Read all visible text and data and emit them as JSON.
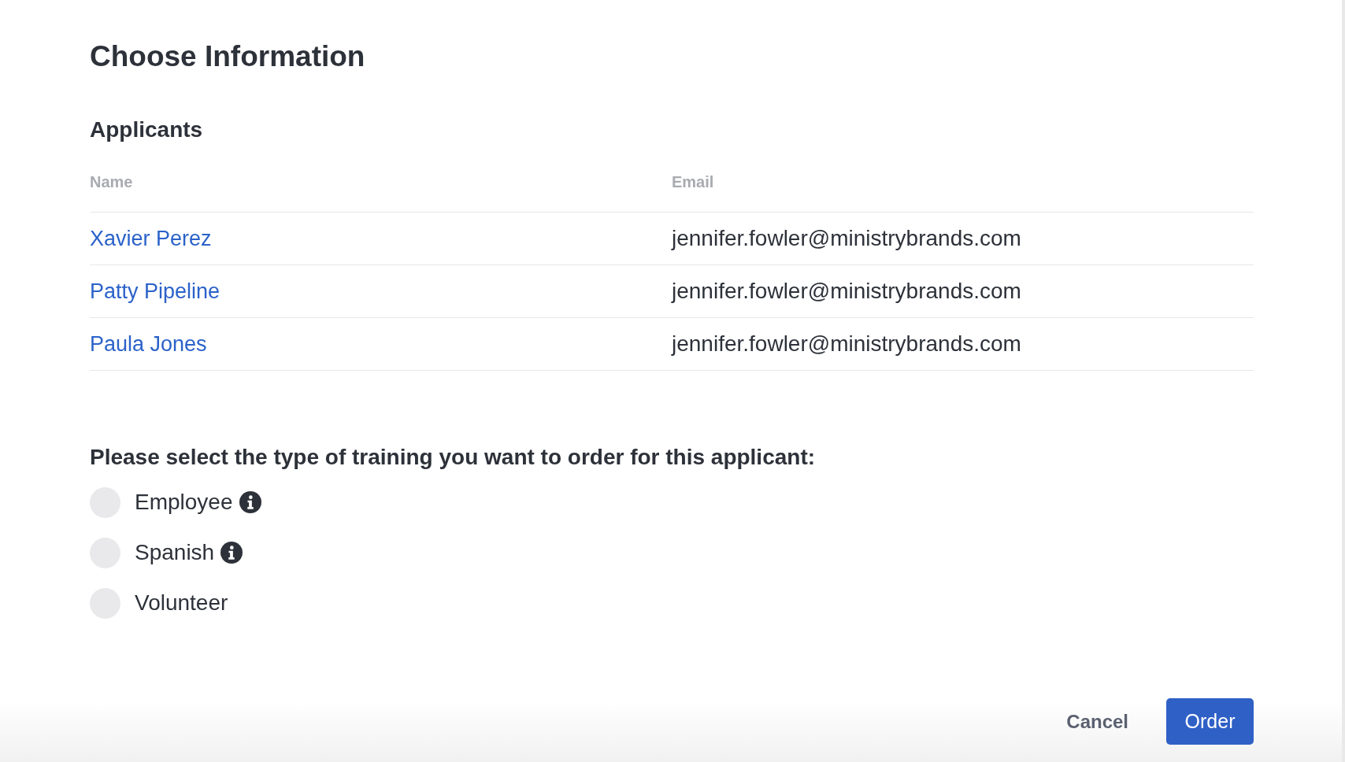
{
  "dialog": {
    "title": "Choose Information"
  },
  "applicants": {
    "heading": "Applicants",
    "columns": [
      "Name",
      "Email"
    ],
    "rows": [
      {
        "name": "Xavier Perez",
        "email": "jennifer.fowler@ministrybrands.com"
      },
      {
        "name": "Patty Pipeline",
        "email": "jennifer.fowler@ministrybrands.com"
      },
      {
        "name": "Paula Jones",
        "email": "jennifer.fowler@ministrybrands.com"
      }
    ]
  },
  "training": {
    "question": "Please select the type of training you want to order for this applicant:",
    "options": [
      {
        "label": "Employee",
        "info": true,
        "selected": false
      },
      {
        "label": "Spanish",
        "info": true,
        "selected": false
      },
      {
        "label": "Volunteer",
        "info": false,
        "selected": false
      }
    ]
  },
  "buttons": [
    {
      "label": "Cancel",
      "kind": "secondary"
    },
    {
      "label": "Order",
      "kind": "primary"
    }
  ]
}
